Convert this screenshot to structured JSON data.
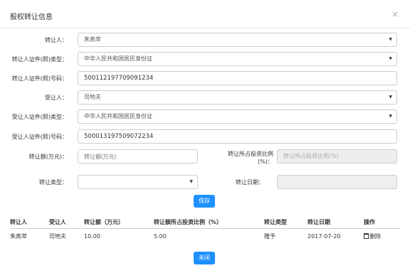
{
  "modal": {
    "title": "股权转让信息",
    "close_icon": "×"
  },
  "form": {
    "transferor": {
      "label": "转让人：",
      "value": "朱燕苹"
    },
    "transferor_id_type": {
      "label": "转让人证件(照)类型：",
      "value": "中华人民共和国居民身份证"
    },
    "transferor_id_no": {
      "label": "转让人证件(照)号码：",
      "value": "500112197709091234"
    },
    "transferee": {
      "label": "受让人：",
      "value": "司地夫"
    },
    "transferee_id_type": {
      "label": "受让人证件(照)类型：",
      "value": "中华人民共和国居民身份证"
    },
    "transferee_id_no": {
      "label": "受让人证件(照)号码：",
      "value": "500013197509072234"
    },
    "amount": {
      "label": "转让额(万元)：",
      "placeholder": "转让额(万元)"
    },
    "ratio": {
      "label_line1": "转让所占投资比例",
      "label_line2": "(%)：",
      "placeholder": "转让所占投资比例(%)"
    },
    "transfer_type": {
      "label": "转让类型：",
      "value": ""
    },
    "transfer_date": {
      "label": "转让日期：",
      "value": ""
    },
    "save_label": "保存"
  },
  "table": {
    "headers": [
      "转让人",
      "受让人",
      "转让额（万元）",
      "转让额所占投资比例（%）",
      "转让类型",
      "转让日期",
      "操作"
    ],
    "rows": [
      {
        "transferor": "朱燕苹",
        "transferee": "司地夫",
        "amount": "10.00",
        "ratio": "5.00",
        "type": "赠予",
        "date": "2017-07-20",
        "action": "删除"
      }
    ]
  },
  "footer": {
    "close_label": "关闭"
  },
  "icons": {
    "dropdown": "caret-down-icon",
    "delete": "trash-icon",
    "close": "close-icon"
  },
  "colors": {
    "primary": "#1e90ff"
  }
}
